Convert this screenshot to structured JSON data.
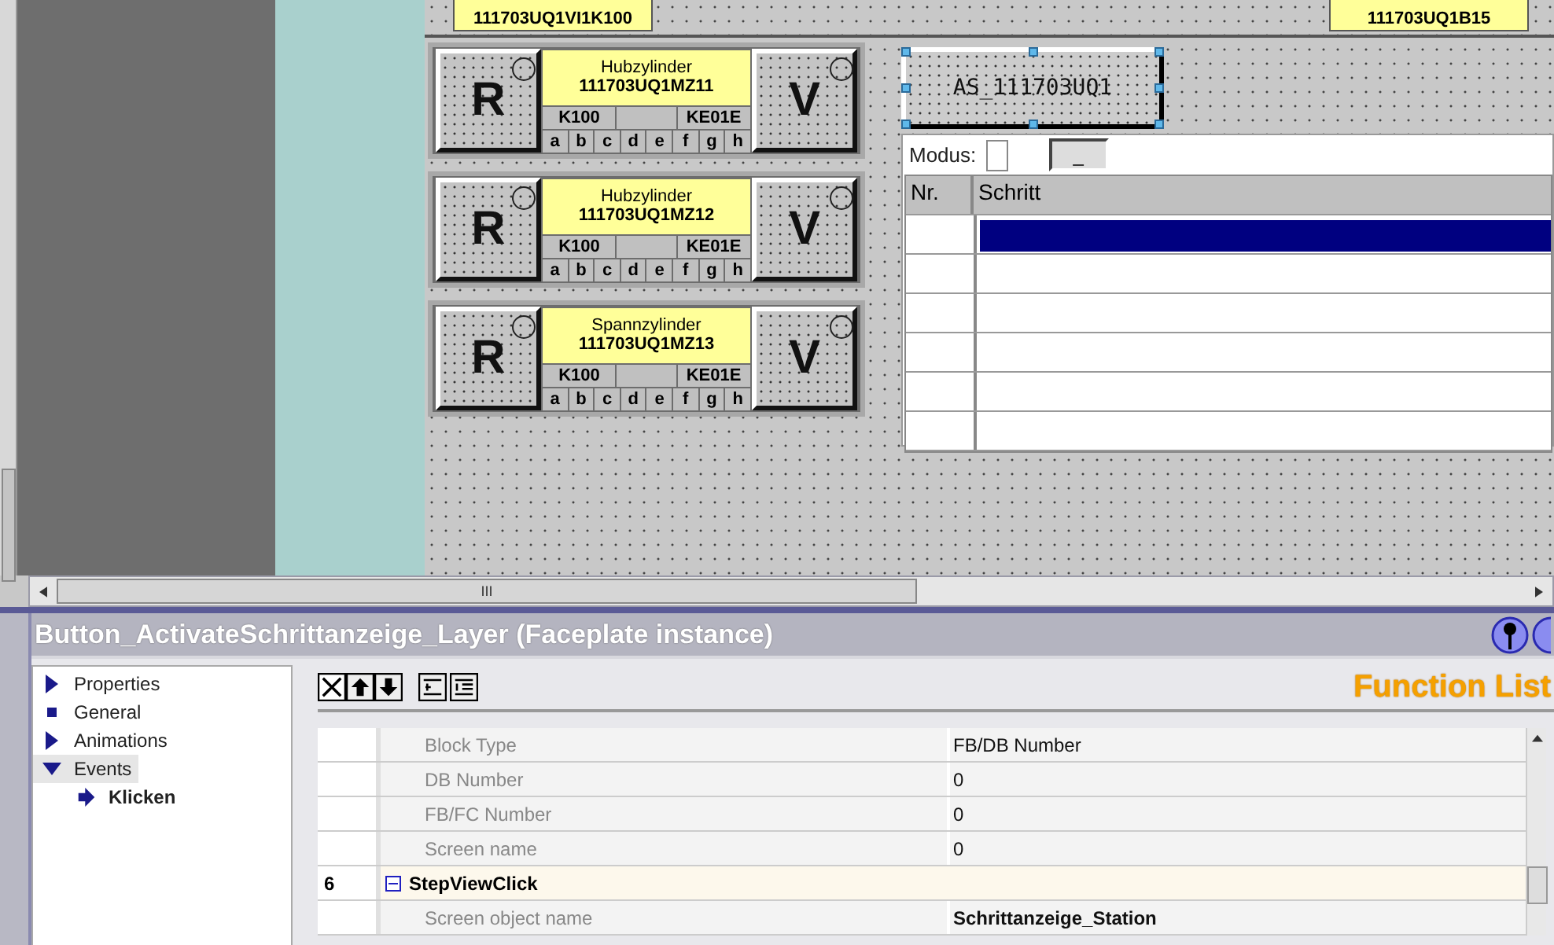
{
  "top_labels": [
    {
      "text": "111703UQ1VI1K100"
    },
    {
      "text": "111703UQ1B15"
    }
  ],
  "faceplates": [
    {
      "left_button": "R",
      "right_button": "V",
      "type": "Hubzylinder",
      "id": "111703UQ1MZ11",
      "code_left": "K100",
      "code_right": "KE01E",
      "signals": [
        "a",
        "b",
        "c",
        "d",
        "e",
        "f",
        "g",
        "h"
      ]
    },
    {
      "left_button": "R",
      "right_button": "V",
      "type": "Hubzylinder",
      "id": "111703UQ1MZ12",
      "code_left": "K100",
      "code_right": "KE01E",
      "signals": [
        "a",
        "b",
        "c",
        "d",
        "e",
        "f",
        "g",
        "h"
      ]
    },
    {
      "left_button": "R",
      "right_button": "V",
      "type": "Spannzylinder",
      "id": "111703UQ1MZ13",
      "code_left": "K100",
      "code_right": "KE01E",
      "signals": [
        "a",
        "b",
        "c",
        "d",
        "e",
        "f",
        "g",
        "h"
      ]
    }
  ],
  "as_button": {
    "label": "AS_111703UQ1",
    "selected": true
  },
  "step_view": {
    "mode_label": "Modus:",
    "mode_checked": false,
    "mode_button": "_",
    "columns": [
      "Nr.",
      "Schritt"
    ],
    "rows": [
      {
        "selected": true
      },
      {
        "selected": false
      },
      {
        "selected": false
      },
      {
        "selected": false
      },
      {
        "selected": false
      },
      {
        "selected": false
      }
    ]
  },
  "scroll_grip": "III",
  "properties_panel": {
    "title": "Button_ActivateSchrittanzeige_Layer (Faceplate instance)",
    "tree": [
      {
        "label": "Properties",
        "kind": "branch",
        "expanded": false,
        "selected": false
      },
      {
        "label": "General",
        "kind": "leaf",
        "selected": false
      },
      {
        "label": "Animations",
        "kind": "branch",
        "expanded": false,
        "selected": false
      },
      {
        "label": "Events",
        "kind": "branch",
        "expanded": true,
        "selected": true,
        "children": [
          {
            "label": "Klicken",
            "kind": "event",
            "selected": false
          }
        ]
      }
    ],
    "heading": "Function List",
    "rows": [
      {
        "kind": "property",
        "name": "Block Type",
        "value": "FB/DB Number",
        "bold": false
      },
      {
        "kind": "property",
        "name": "DB Number",
        "value": "0",
        "bold": false
      },
      {
        "kind": "property",
        "name": "FB/FC Number",
        "value": "0",
        "bold": false
      },
      {
        "kind": "property",
        "name": "Screen name",
        "value": "0",
        "bold": false
      },
      {
        "kind": "group",
        "number": "6",
        "name": "StepViewClick",
        "expanded": true
      },
      {
        "kind": "property",
        "name": "Screen object name",
        "value": "Schrittanzeige_Station",
        "bold": true
      }
    ]
  }
}
